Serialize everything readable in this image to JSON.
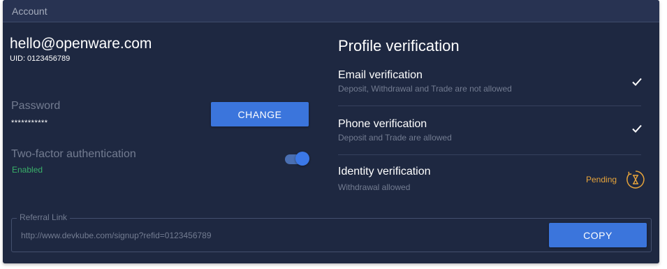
{
  "header": {
    "title": "Account"
  },
  "account": {
    "email": "hello@openware.com",
    "uid": "UID: 0123456789"
  },
  "password": {
    "label": "Password",
    "value": "***********",
    "change_label": "CHANGE"
  },
  "two_factor": {
    "label": "Two-factor authentication",
    "status": "Enabled",
    "enabled": true
  },
  "profile_verification": {
    "title": "Profile verification",
    "items": [
      {
        "name": "Email verification",
        "description": "Deposit, Withdrawal and Trade are not allowed",
        "status_icon": "check-icon"
      },
      {
        "name": "Phone verification",
        "description": "Deposit and Trade are allowed",
        "status_icon": "check-icon"
      },
      {
        "name": "Identity verification",
        "description": "Withdrawal allowed",
        "status_text": "Pending",
        "status_icon": "hourglass-icon"
      }
    ]
  },
  "referral": {
    "legend": "Referral Link",
    "url": "http://www.devkube.com/signup?refid=0123456789",
    "copy_label": "COPY"
  },
  "colors": {
    "card_background": "#1e2841",
    "header_background": "#283352",
    "primary_button": "#3b75dc",
    "enabled_green": "#3ab06a",
    "pending_orange": "#e7a43b",
    "muted_text": "#737c91"
  }
}
